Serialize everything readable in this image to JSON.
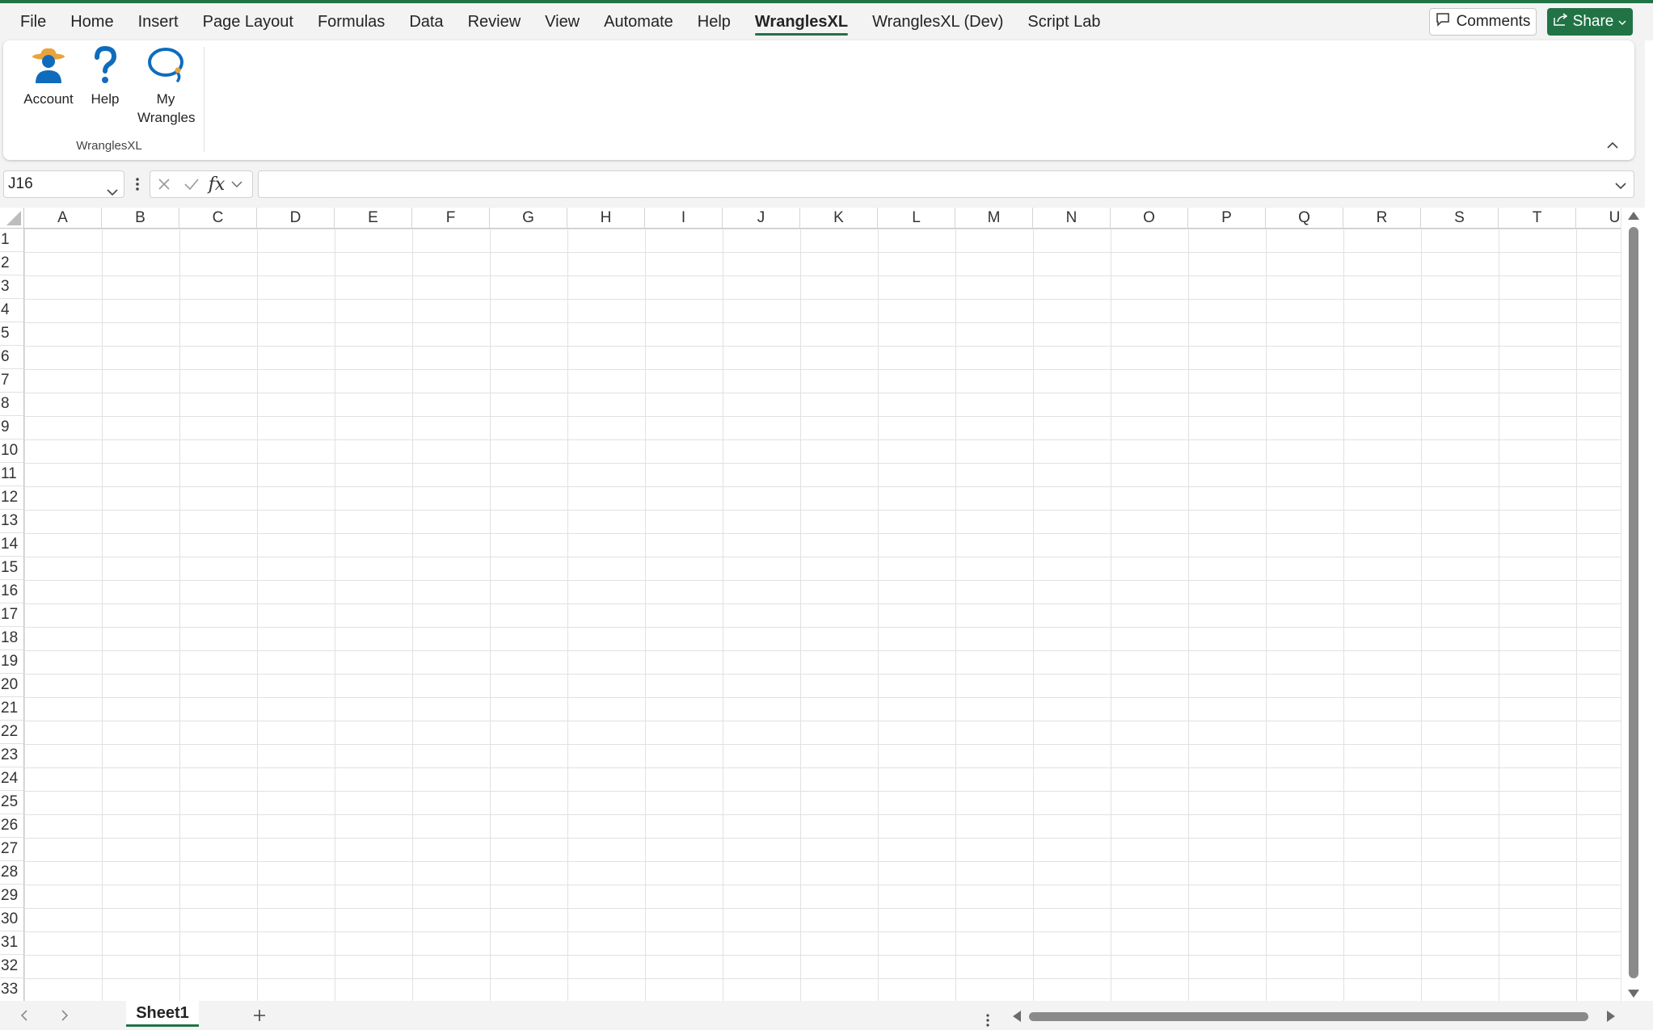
{
  "menu": {
    "tabs": [
      "File",
      "Home",
      "Insert",
      "Page Layout",
      "Formulas",
      "Data",
      "Review",
      "View",
      "Automate",
      "Help",
      "WranglesXL",
      "WranglesXL (Dev)",
      "Script Lab"
    ],
    "active_tab": "WranglesXL",
    "comments_label": "Comments",
    "share_label": "Share"
  },
  "ribbon": {
    "buttons": [
      {
        "label": "Account",
        "icon": "account-cowboy-icon"
      },
      {
        "label": "Help",
        "icon": "question-mark-icon"
      },
      {
        "label": "My Wrangles",
        "icon": "lasso-icon"
      }
    ],
    "group_label": "WranglesXL"
  },
  "formula_bar": {
    "name_box": "J16",
    "formula": ""
  },
  "grid": {
    "columns": [
      "A",
      "B",
      "C",
      "D",
      "E",
      "F",
      "G",
      "H",
      "I",
      "J",
      "K",
      "L",
      "M",
      "N",
      "O",
      "P",
      "Q",
      "R",
      "S",
      "T",
      "U"
    ],
    "rows": [
      "1",
      "2",
      "3",
      "4",
      "5",
      "6",
      "7",
      "8",
      "9",
      "10",
      "11",
      "12",
      "13",
      "14",
      "15",
      "16",
      "17",
      "18",
      "19",
      "20",
      "21",
      "22",
      "23",
      "24",
      "25",
      "26",
      "27",
      "28",
      "29",
      "30",
      "31",
      "32",
      "33"
    ]
  },
  "sheets": {
    "tabs": [
      "Sheet1"
    ],
    "active": "Sheet1"
  },
  "colors": {
    "accent": "#217346",
    "icon_blue": "#0f6cbd",
    "hat_gold": "#e8a33d"
  }
}
